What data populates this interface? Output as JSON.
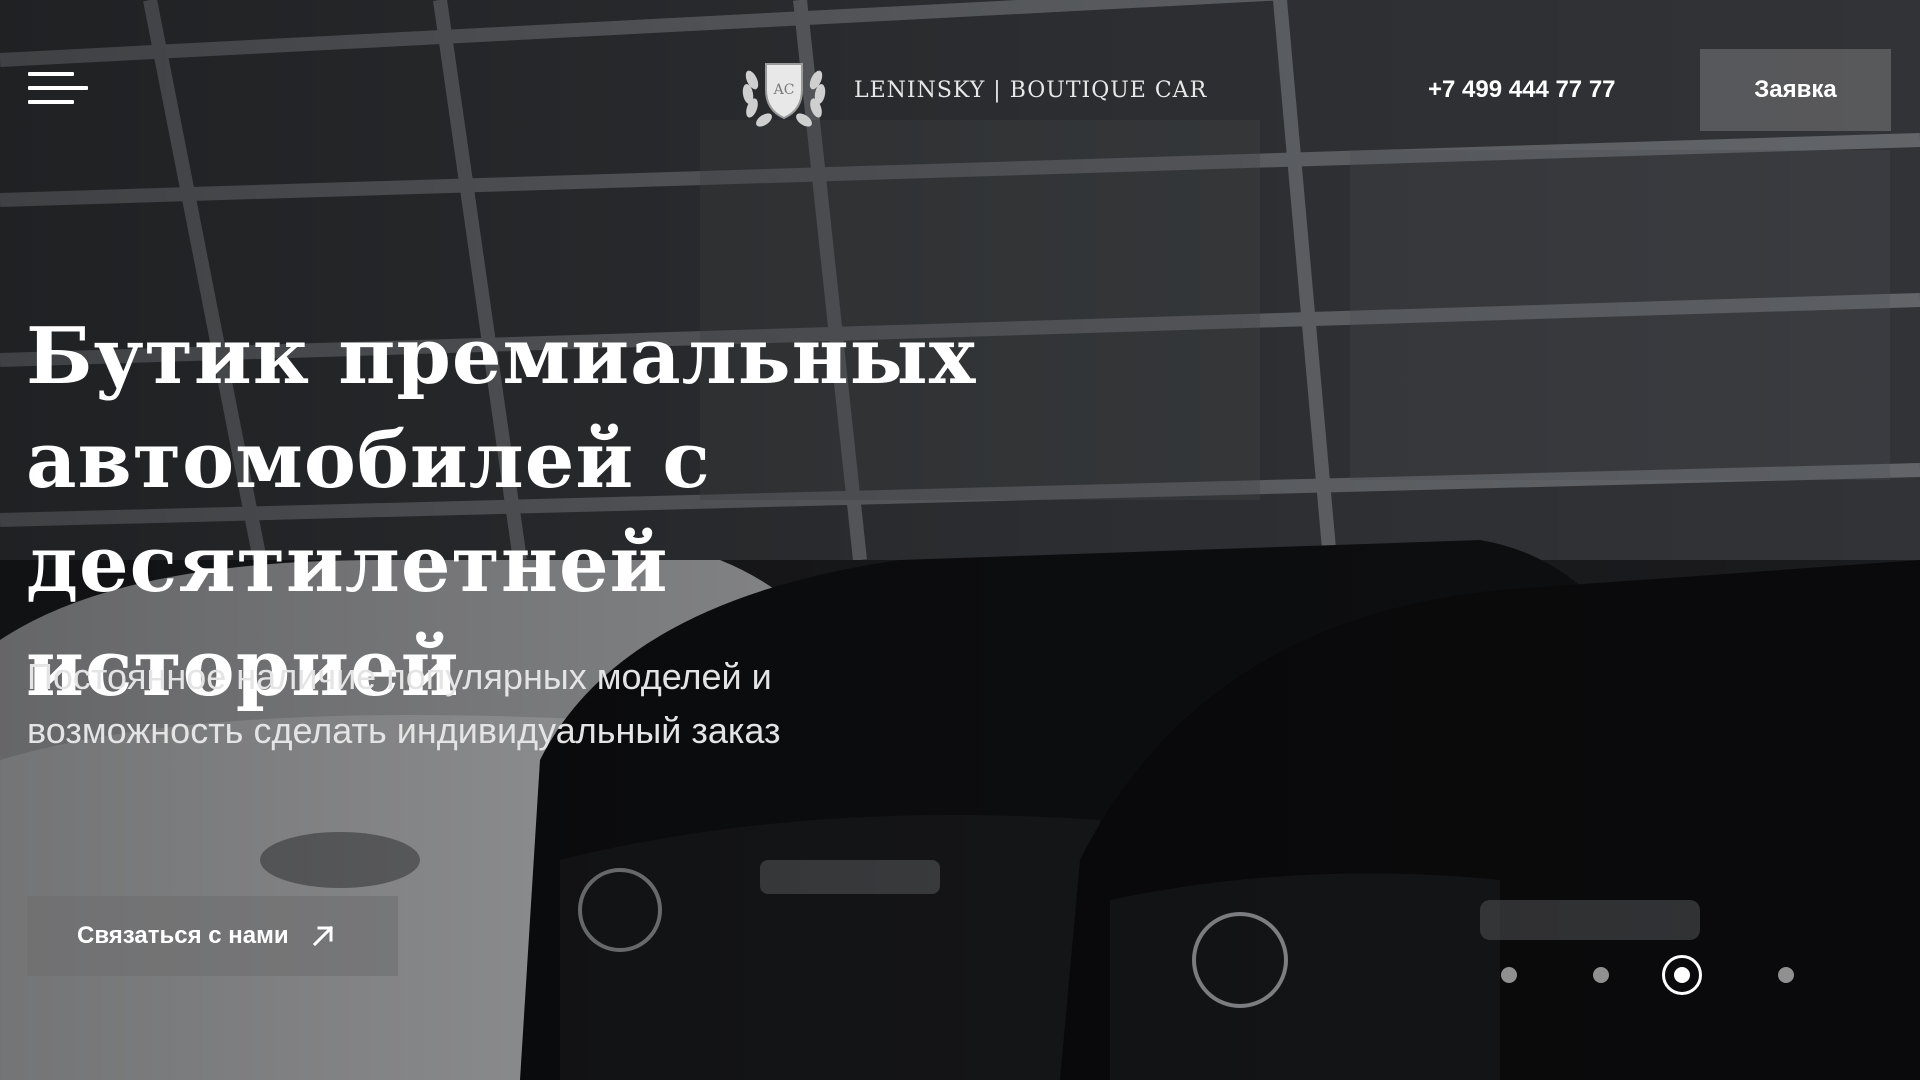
{
  "header": {
    "menu_label": "",
    "logo": {
      "emblem_text": "AC",
      "brand_text": "LENINSKY | BOUTIQUE CAR"
    },
    "phone": "+7 499 444 77 77",
    "request_button_label": "Заявка"
  },
  "hero": {
    "headline_lines": [
      "Бутик премиальных",
      "автомобилей с",
      "десятилетней историей"
    ],
    "subline_lines": [
      "Постоянное наличие популярных моделей и",
      "возможность сделать индивидуальный заказ"
    ],
    "contact_button_label": "Связаться с нами"
  },
  "slider": {
    "slide_count": 4,
    "active_index": 2
  },
  "colors": {
    "text": "#ffffff",
    "button_bg": "#6e6e70"
  }
}
